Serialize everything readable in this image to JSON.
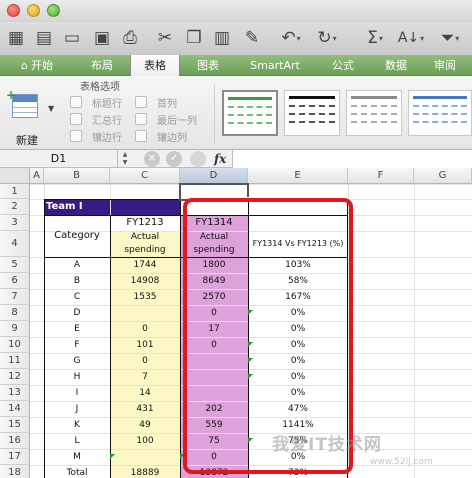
{
  "window": {
    "controls": [
      "close",
      "minimize",
      "zoom"
    ]
  },
  "toolbar": {
    "buttons": [
      "new-workbook",
      "templates",
      "open",
      "save",
      "print",
      "cut",
      "copy",
      "paste",
      "format-painter",
      "undo",
      "redo",
      "autosum",
      "sort",
      "filter"
    ]
  },
  "ribbon": {
    "tabs": [
      "开始",
      "布局",
      "表格",
      "图表",
      "SmartArt",
      "公式",
      "数据",
      "审阅"
    ],
    "active_tab": "表格",
    "group_title": "表格选项",
    "new_label": "新建",
    "options": [
      "标题行",
      "汇总行",
      "镶边行",
      "首列",
      "最后一列",
      "镶边列"
    ]
  },
  "formula_bar": {
    "name_box": "D1",
    "fx": "fx",
    "formula": ""
  },
  "sheet": {
    "columns": [
      "A",
      "B",
      "C",
      "D",
      "E",
      "F",
      "G"
    ],
    "rows": [
      "1",
      "2",
      "3",
      "4",
      "5",
      "6",
      "7",
      "8",
      "9",
      "10",
      "11",
      "12",
      "13",
      "14",
      "15",
      "16",
      "17",
      "18"
    ],
    "team": "Team I",
    "header": {
      "category": "Category",
      "fy1213": "FY1213",
      "fy1314": "FY1314",
      "c_sub": "Actual spending",
      "d_sub": "Actual spending",
      "e_head": "FY1314 Vs FY1213 (%)"
    },
    "data": [
      {
        "cat": "A",
        "c": "1744",
        "d": "1800",
        "e": "103%"
      },
      {
        "cat": "B",
        "c": "14908",
        "d": "8649",
        "e": "58%"
      },
      {
        "cat": "C",
        "c": "1535",
        "d": "2570",
        "e": "167%"
      },
      {
        "cat": "D",
        "c": "",
        "d": "0",
        "e": "0%"
      },
      {
        "cat": "E",
        "c": "0",
        "d": "17",
        "e": "0%"
      },
      {
        "cat": "F",
        "c": "101",
        "d": "0",
        "e": "0%"
      },
      {
        "cat": "G",
        "c": "0",
        "d": "",
        "e": "0%"
      },
      {
        "cat": "H",
        "c": "7",
        "d": "",
        "e": "0%"
      },
      {
        "cat": "I",
        "c": "14",
        "d": "",
        "e": "0%"
      },
      {
        "cat": "J",
        "c": "431",
        "d": "202",
        "e": "47%"
      },
      {
        "cat": "K",
        "c": "49",
        "d": "559",
        "e": "1141%"
      },
      {
        "cat": "L",
        "c": "100",
        "d": "75",
        "e": "75%"
      },
      {
        "cat": "M",
        "c": "",
        "d": "0",
        "e": "0%"
      },
      {
        "cat": "Total",
        "c": "18889",
        "d": "13872",
        "e": "73%"
      }
    ]
  },
  "watermark": {
    "text": "我爱IT技术网",
    "url": "www.52ij.com"
  },
  "colors": {
    "ribbon_green": "#6c9e57",
    "team_purple": "#3a1b86",
    "yellow_fill": "#fbf8c5",
    "pink_fill": "#dca2d9",
    "highlight_red": "#e0171d"
  }
}
